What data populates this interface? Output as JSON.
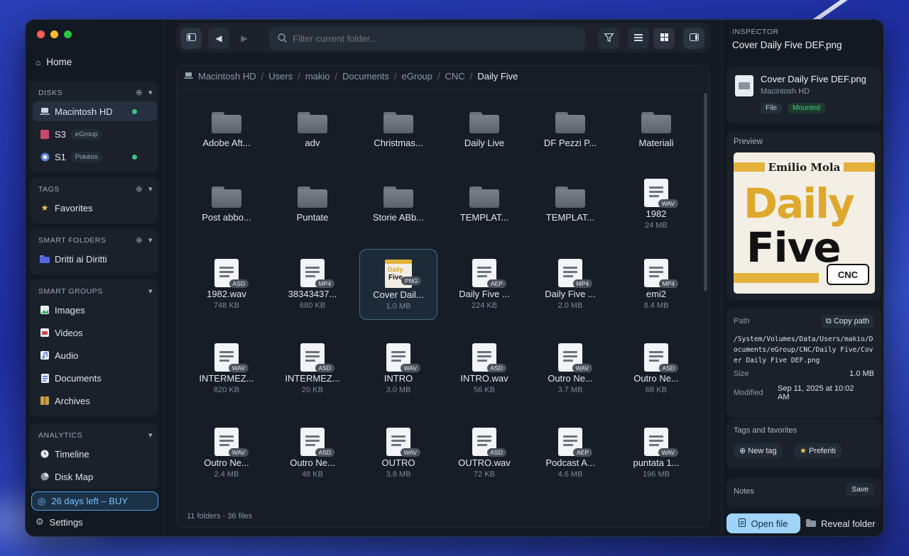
{
  "sidebar": {
    "home_label": "Home",
    "disks": {
      "header": "DISKS",
      "items": [
        {
          "label": "Macintosh HD",
          "pill": "",
          "mounted": true
        },
        {
          "label": "S3",
          "pill": "eGroup",
          "mounted": false
        },
        {
          "label": "S1",
          "pill": "Pokéos",
          "mounted": true
        }
      ]
    },
    "tags": {
      "header": "TAGS",
      "items": [
        {
          "label": "Favorites"
        }
      ]
    },
    "smart_folders": {
      "header": "SMART FOLDERS",
      "items": [
        {
          "label": "Dritti ai Diritti"
        }
      ]
    },
    "smart_groups": {
      "header": "SMART GROUPS",
      "items": [
        {
          "label": "Images",
          "icon": "image-icon"
        },
        {
          "label": "Videos",
          "icon": "video-icon"
        },
        {
          "label": "Audio",
          "icon": "audio-icon"
        },
        {
          "label": "Documents",
          "icon": "document-icon"
        },
        {
          "label": "Archives",
          "icon": "archive-icon"
        }
      ]
    },
    "analytics": {
      "header": "ANALYTICS",
      "items": [
        {
          "label": "Timeline",
          "icon": "clock-icon"
        },
        {
          "label": "Disk Map",
          "icon": "pie-icon"
        }
      ]
    },
    "trial_label": "26 days left – BUY",
    "settings_label": "Settings"
  },
  "toolbar": {
    "search_placeholder": "Filter current folder..."
  },
  "breadcrumb": [
    "Macintosh HD",
    "Users",
    "makio",
    "Documents",
    "eGroup",
    "CNC",
    "Daily Five"
  ],
  "files": [
    {
      "name": "Adobe Aft...",
      "kind": "folder"
    },
    {
      "name": "adv",
      "kind": "folder"
    },
    {
      "name": "Christmas...",
      "kind": "folder"
    },
    {
      "name": "Daily Live",
      "kind": "folder"
    },
    {
      "name": "DF Pezzi P...",
      "kind": "folder"
    },
    {
      "name": "Materiali",
      "kind": "folder"
    },
    {
      "name": "Post abbo...",
      "kind": "folder"
    },
    {
      "name": "Puntate",
      "kind": "folder"
    },
    {
      "name": "Storie ABb...",
      "kind": "folder"
    },
    {
      "name": "TEMPLAT...",
      "kind": "folder"
    },
    {
      "name": "TEMPLAT...",
      "kind": "folder"
    },
    {
      "name": "1982",
      "kind": "file",
      "badge": "WAV",
      "size": "24 MB"
    },
    {
      "name": "1982.wav",
      "kind": "file",
      "badge": "ASD",
      "size": "748 KB"
    },
    {
      "name": "38343437...",
      "kind": "file",
      "badge": "MP4",
      "size": "680 KB"
    },
    {
      "name": "Cover Dail...",
      "kind": "image",
      "badge": "PNG",
      "size": "1.0 MB",
      "selected": true
    },
    {
      "name": "Daily Five ...",
      "kind": "file",
      "badge": "AEP",
      "size": "224 KB"
    },
    {
      "name": "Daily Five ...",
      "kind": "file",
      "badge": "MP4",
      "size": "2.0 MB"
    },
    {
      "name": "emi2",
      "kind": "file",
      "badge": "MP4",
      "size": "8.4 MB"
    },
    {
      "name": "INTERMEZ...",
      "kind": "file",
      "badge": "WAV",
      "size": "820 KB"
    },
    {
      "name": "INTERMEZ...",
      "kind": "file",
      "badge": "ASD",
      "size": "20 KB"
    },
    {
      "name": "INTRO",
      "kind": "file",
      "badge": "WAV",
      "size": "3.0 MB"
    },
    {
      "name": "INTRO.wav",
      "kind": "file",
      "badge": "ASD",
      "size": "56 KB"
    },
    {
      "name": "Outro Ne...",
      "kind": "file",
      "badge": "WAV",
      "size": "3.7 MB"
    },
    {
      "name": "Outro Ne...",
      "kind": "file",
      "badge": "ASD",
      "size": "68 KB"
    },
    {
      "name": "Outro Ne...",
      "kind": "file",
      "badge": "WAV",
      "size": "2.4 MB"
    },
    {
      "name": "Outro Ne...",
      "kind": "file",
      "badge": "ASD",
      "size": "48 KB"
    },
    {
      "name": "OUTRO",
      "kind": "file",
      "badge": "WAV",
      "size": "3.8 MB"
    },
    {
      "name": "OUTRO.wav",
      "kind": "file",
      "badge": "ASD",
      "size": "72 KB"
    },
    {
      "name": "Podcast A...",
      "kind": "file",
      "badge": "AEP",
      "size": "4.6 MB"
    },
    {
      "name": "puntata 1...",
      "kind": "file",
      "badge": "WAV",
      "size": "196 MB"
    }
  ],
  "status_text": "11 folders · 36 files",
  "inspector": {
    "label": "INSPECTOR",
    "title": "Cover Daily Five DEF.png",
    "file_name": "Cover Daily Five DEF.png",
    "volume": "Macintosh HD",
    "chip_kind": "File",
    "chip_state": "Mounted",
    "preview_label": "Preview",
    "cover_author": "Emilio Mola",
    "cover_line1": "Daily",
    "cover_line2": "Five",
    "cover_logo": "CNC",
    "path_label": "Path",
    "copy_label": "Copy path",
    "path_value": "/System/Volumes/Data/Users/makio/Documents/eGroup/CNC/Daily Five/Cover Daily Five DEF.png",
    "size_label": "Size",
    "size_value": "1.0 MB",
    "modified_label": "Modified",
    "modified_value": "Sep 11, 2025 at 10:02 AM",
    "tags_label": "Tags and favorites",
    "new_tag_label": "New tag",
    "preferiti_label": "Preferiti",
    "notes_label": "Notes",
    "save_label": "Save",
    "open_label": "Open file",
    "reveal_label": "Reveal folder"
  },
  "colors": {
    "accent": "#9dd4f7",
    "mounted": "#34c780",
    "trial": "#4ea0e6"
  }
}
